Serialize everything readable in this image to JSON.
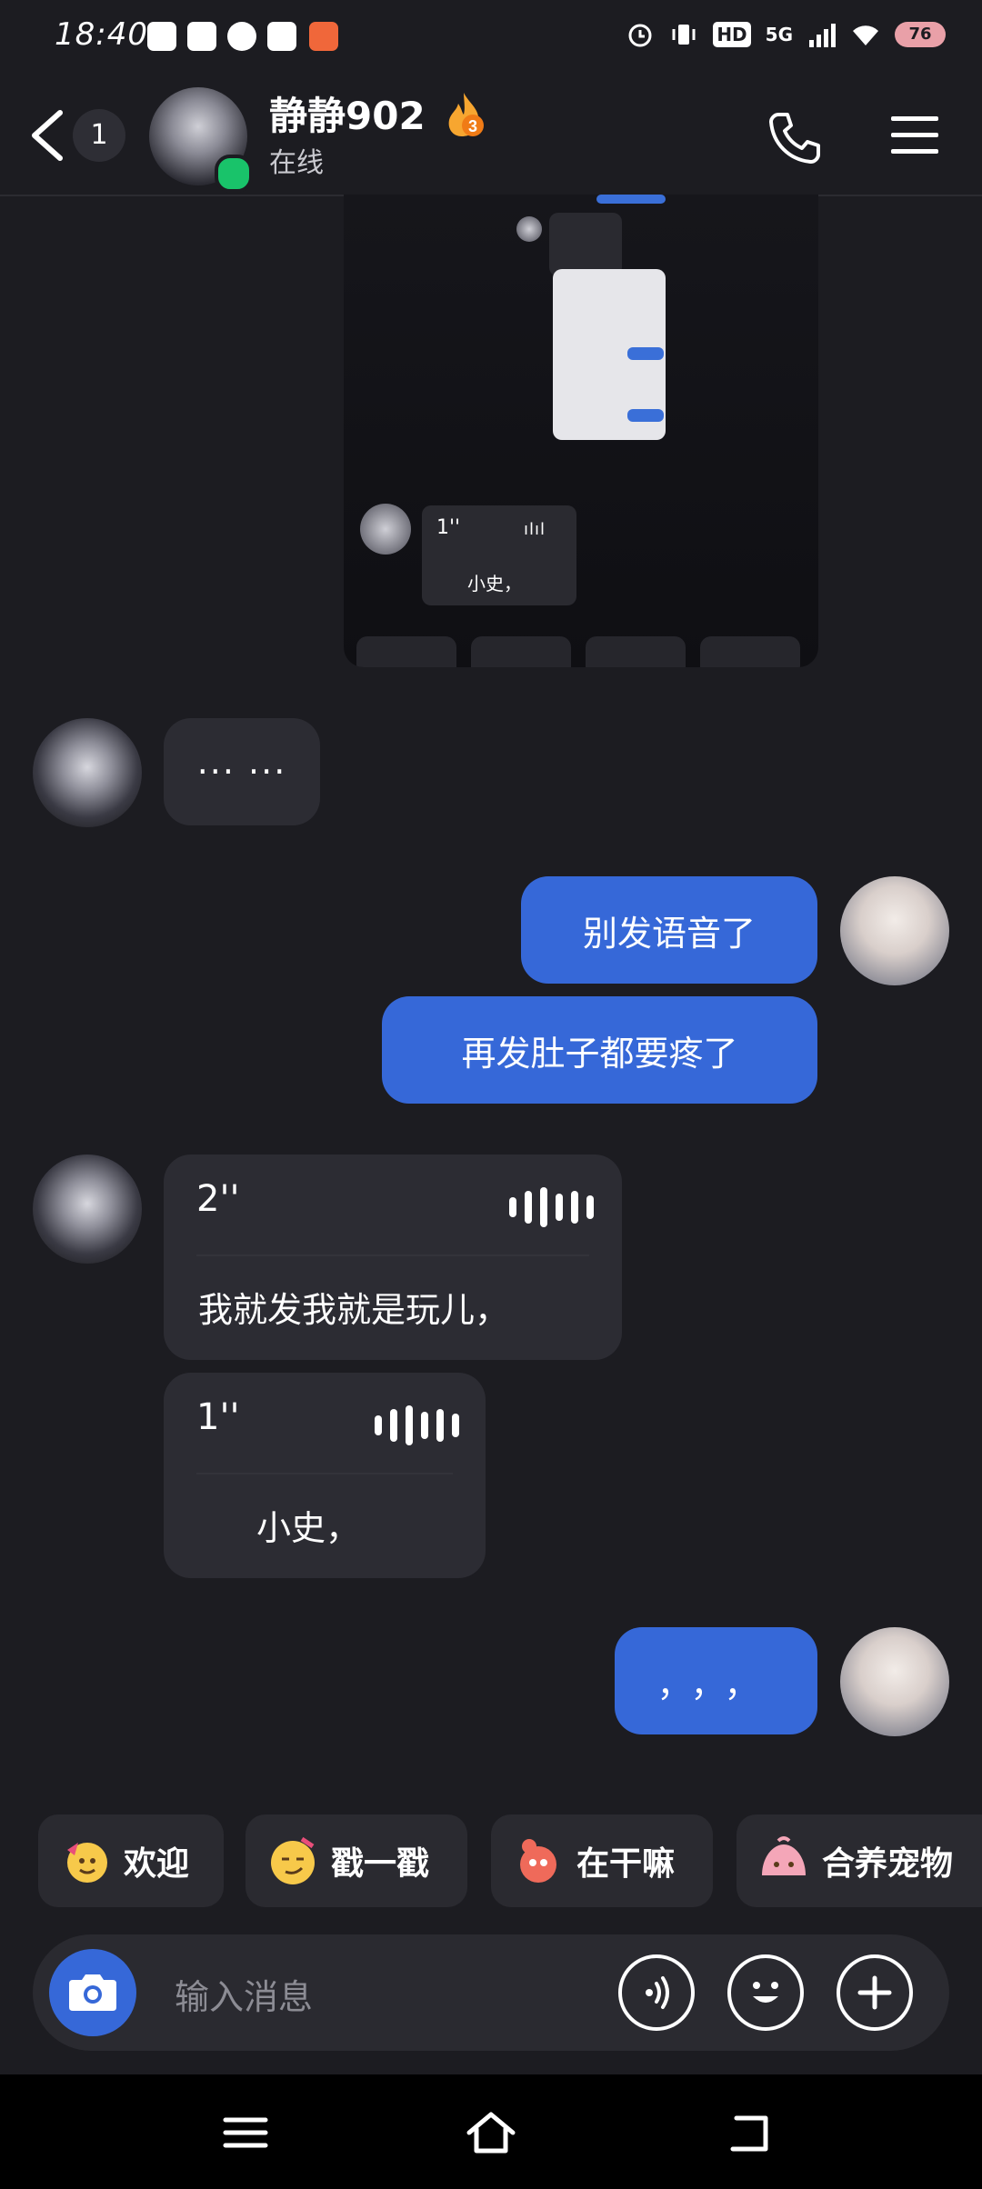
{
  "status_bar": {
    "time": "18:40",
    "network": "5G",
    "hd": "HD",
    "battery": "76"
  },
  "header": {
    "unread_count": "1",
    "contact_name": "静静902",
    "streak_count": "3",
    "status": "在线"
  },
  "messages": {
    "friend_dots": "··· ···",
    "self_1": "别发语音了",
    "self_2": "再发肚子都要疼了",
    "voice_1": {
      "duration": "2''",
      "transcript": "我就发我就是玩儿，"
    },
    "voice_2": {
      "duration": "1''",
      "transcript": "小史，"
    },
    "self_3": "，，，"
  },
  "forwarded_image": {
    "voice_duration": "1''",
    "voice_transcript": "小史，"
  },
  "quick_replies": [
    "欢迎",
    "戳一戳",
    "在干嘛",
    "合养宠物"
  ],
  "input": {
    "placeholder": "输入消息"
  },
  "colors": {
    "background": "#1c1c21",
    "bubble_gray": "#2c2c33",
    "bubble_blue": "#3668d8",
    "online": "#19c36a"
  }
}
